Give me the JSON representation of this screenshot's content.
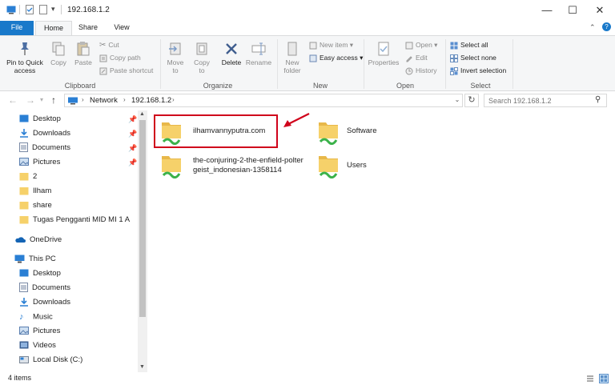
{
  "window": {
    "title": "192.168.1.2"
  },
  "ribbon_tabs": {
    "file": "File",
    "home": "Home",
    "share": "Share",
    "view": "View"
  },
  "ribbon": {
    "clipboard": {
      "label": "Clipboard",
      "pin": "Pin to Quick access",
      "copy": "Copy",
      "paste": "Paste",
      "cut": "Cut",
      "copy_path": "Copy path",
      "paste_shortcut": "Paste shortcut"
    },
    "organize": {
      "label": "Organize",
      "move_to": "Move to",
      "copy_to": "Copy to",
      "delete": "Delete",
      "rename": "Rename"
    },
    "new": {
      "label": "New",
      "new_folder": "New folder",
      "new_item": "New item",
      "easy_access": "Easy access"
    },
    "open": {
      "label": "Open",
      "properties": "Properties",
      "open": "Open",
      "edit": "Edit",
      "history": "History"
    },
    "select": {
      "label": "Select",
      "select_all": "Select all",
      "select_none": "Select none",
      "invert": "Invert selection"
    }
  },
  "address": {
    "crumbs": [
      "Network",
      "192.168.1.2"
    ],
    "search_placeholder": "Search 192.168.1.2"
  },
  "nav": {
    "quick_access": [
      {
        "label": "Desktop",
        "pinned": true
      },
      {
        "label": "Downloads",
        "pinned": true
      },
      {
        "label": "Documents",
        "pinned": true
      },
      {
        "label": "Pictures",
        "pinned": true
      },
      {
        "label": "2",
        "pinned": false
      },
      {
        "label": "Ilham",
        "pinned": false
      },
      {
        "label": "share",
        "pinned": false
      },
      {
        "label": "Tugas Pengganti MID MI 1 A",
        "pinned": false
      }
    ],
    "onedrive": "OneDrive",
    "this_pc": "This PC",
    "this_pc_items": [
      "Desktop",
      "Documents",
      "Downloads",
      "Music",
      "Pictures",
      "Videos",
      "Local Disk (C:)"
    ]
  },
  "files": [
    {
      "name": "ilhamvannyputra.com"
    },
    {
      "name": "Software"
    },
    {
      "name": "the-conjuring-2-the-enfield-poltergeist_indonesian-1358114",
      "line1": "the-conjuring-2-the-enfield-polter",
      "line2": "geist_indonesian-1358114"
    },
    {
      "name": "Users"
    }
  ],
  "status": {
    "count": "4 items"
  },
  "colors": {
    "accent": "#1979ca",
    "highlight": "#d0021b",
    "folder": "#f6d16a",
    "share_badge": "#3bb24a"
  }
}
